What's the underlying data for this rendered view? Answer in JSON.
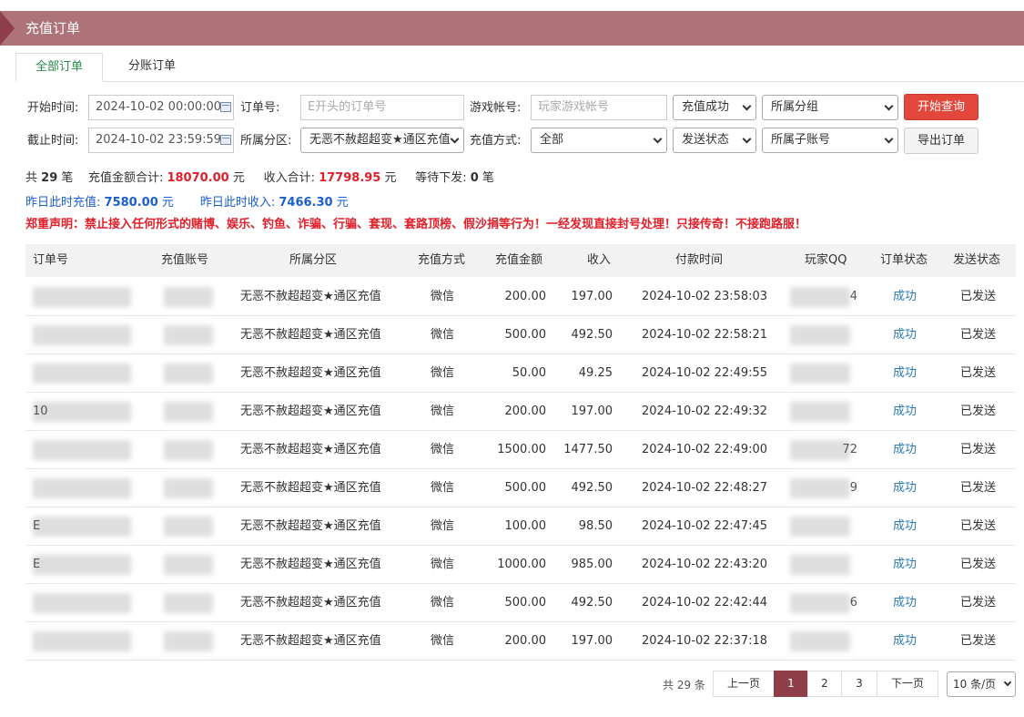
{
  "header": {
    "title": "充值订单"
  },
  "tabs": [
    {
      "label": "全部订单"
    },
    {
      "label": "分账订单"
    }
  ],
  "filters": {
    "start_time": {
      "label": "开始时间:",
      "value": "2024-10-02 00:00:00"
    },
    "end_time": {
      "label": "截止时间:",
      "value": "2024-10-02 23:59:59"
    },
    "order_no": {
      "label": "订单号:",
      "placeholder": "E开头的订单号"
    },
    "zone": {
      "label": "所属分区:",
      "value": "无恶不赦超超变★通区充值"
    },
    "game_account": {
      "label": "游戏帐号:",
      "placeholder": "玩家游戏帐号"
    },
    "pay_method": {
      "label": "充值方式:",
      "value": "全部"
    },
    "recharge_status": {
      "value": "充值成功"
    },
    "send_status": {
      "value": "发送状态"
    },
    "group": {
      "value": "所属分组"
    },
    "sub_account": {
      "value": "所属子账号"
    },
    "search_button": "开始查询",
    "export_button": "导出订单"
  },
  "summary": {
    "count_prefix": "共",
    "count": "29",
    "count_suffix": "笔",
    "total_label": "充值金额合计:",
    "total_value": "18070.00",
    "income_label": "收入合计:",
    "income_value": "17798.95",
    "yuan": "元",
    "pending_label": "等待下发:",
    "pending_value": "0",
    "pending_suffix": "笔",
    "yesterday_recharge_label": "昨日此时充值:",
    "yesterday_recharge_value": "7580.00",
    "yesterday_income_label": "昨日此时收入:",
    "yesterday_income_value": "7466.30",
    "warning": "郑重声明：禁止接入任何形式的赌博、娱乐、钓鱼、诈骗、行骗、套现、套路顶榜、假沙捐等行为！一经发现直接封号处理！只接传奇！不接跑路服！"
  },
  "table": {
    "columns": [
      "订单号",
      "充值账号",
      "所属分区",
      "充值方式",
      "充值金额",
      "收入",
      "付款时间",
      "玩家QQ",
      "订单状态",
      "发送状态"
    ],
    "rows": [
      {
        "order_fragment": "",
        "zone": "无恶不赦超超变★通区充值",
        "method": "微信",
        "amount": "200.00",
        "income": "197.00",
        "time": "2024-10-02 23:58:03",
        "qq_fragment": "4",
        "status": "成功",
        "send": "已发送"
      },
      {
        "order_fragment": "",
        "zone": "无恶不赦超超变★通区充值",
        "method": "微信",
        "amount": "500.00",
        "income": "492.50",
        "time": "2024-10-02 22:58:21",
        "qq_fragment": "",
        "status": "成功",
        "send": "已发送"
      },
      {
        "order_fragment": "",
        "zone": "无恶不赦超超变★通区充值",
        "method": "微信",
        "amount": "50.00",
        "income": "49.25",
        "time": "2024-10-02 22:49:55",
        "qq_fragment": "",
        "status": "成功",
        "send": "已发送"
      },
      {
        "order_fragment": "10",
        "zone": "无恶不赦超超变★通区充值",
        "method": "微信",
        "amount": "200.00",
        "income": "197.00",
        "time": "2024-10-02 22:49:32",
        "qq_fragment": "",
        "status": "成功",
        "send": "已发送"
      },
      {
        "order_fragment": "",
        "zone": "无恶不赦超超变★通区充值",
        "method": "微信",
        "amount": "1500.00",
        "income": "1477.50",
        "time": "2024-10-02 22:49:00",
        "qq_fragment": "72",
        "status": "成功",
        "send": "已发送"
      },
      {
        "order_fragment": "",
        "zone": "无恶不赦超超变★通区充值",
        "method": "微信",
        "amount": "500.00",
        "income": "492.50",
        "time": "2024-10-02 22:48:27",
        "qq_fragment": "9",
        "status": "成功",
        "send": "已发送"
      },
      {
        "order_fragment": "E",
        "zone": "无恶不赦超超变★通区充值",
        "method": "微信",
        "amount": "100.00",
        "income": "98.50",
        "time": "2024-10-02 22:47:45",
        "qq_fragment": "",
        "status": "成功",
        "send": "已发送"
      },
      {
        "order_fragment": "E",
        "zone": "无恶不赦超超变★通区充值",
        "method": "微信",
        "amount": "1000.00",
        "income": "985.00",
        "time": "2024-10-02 22:43:20",
        "qq_fragment": "",
        "status": "成功",
        "send": "已发送"
      },
      {
        "order_fragment": "",
        "zone": "无恶不赦超超变★通区充值",
        "method": "微信",
        "amount": "500.00",
        "income": "492.50",
        "time": "2024-10-02 22:42:44",
        "qq_fragment": "6",
        "status": "成功",
        "send": "已发送"
      },
      {
        "order_fragment": "",
        "zone": "无恶不赦超超变★通区充值",
        "method": "微信",
        "amount": "200.00",
        "income": "197.00",
        "time": "2024-10-02 22:37:18",
        "qq_fragment": "",
        "status": "成功",
        "send": "已发送"
      }
    ]
  },
  "pagination": {
    "total_text": "共 29 条",
    "prev": "上一页",
    "pages": [
      "1",
      "2",
      "3"
    ],
    "current": "1",
    "next": "下一页",
    "page_size": "10 条/页"
  },
  "colors": {
    "header_bg": "#ad7378",
    "accent": "#8e3f49",
    "search_button": "#e3463b",
    "red_text": "#e0202a",
    "blue_text": "#1a5fd0",
    "link": "#2a7ab8"
  }
}
